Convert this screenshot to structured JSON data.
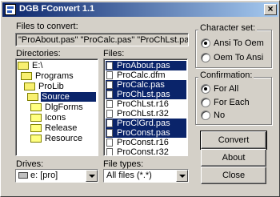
{
  "window": {
    "title": "DGB FConvert 1.1",
    "close_glyph": "×"
  },
  "files_to_convert": {
    "label": "Files to convert:",
    "value": "\"ProAbout.pas\" \"ProCalc.pas\" \"ProChLst.pas\" \"ProClGrd.pas\""
  },
  "directories": {
    "label": "Directories:",
    "items": [
      {
        "label": "E:\\",
        "selected": false
      },
      {
        "label": "Programs",
        "selected": false
      },
      {
        "label": "ProLib",
        "selected": false
      },
      {
        "label": "Source",
        "selected": true
      },
      {
        "label": "DlgForms",
        "selected": false
      },
      {
        "label": "Icons",
        "selected": false
      },
      {
        "label": "Release",
        "selected": false
      },
      {
        "label": "Resource",
        "selected": false
      }
    ]
  },
  "files": {
    "label": "Files:",
    "items": [
      {
        "name": "ProAbout.pas",
        "selected": true
      },
      {
        "name": "ProCalc.dfm",
        "selected": false
      },
      {
        "name": "ProCalc.pas",
        "selected": true
      },
      {
        "name": "ProChLst.pas",
        "selected": true
      },
      {
        "name": "ProChLst.r16",
        "selected": false
      },
      {
        "name": "ProChLst.r32",
        "selected": false
      },
      {
        "name": "ProClGrd.pas",
        "selected": true
      },
      {
        "name": "ProConst.pas",
        "selected": true
      },
      {
        "name": "ProConst.r16",
        "selected": false
      },
      {
        "name": "ProConst.r32",
        "selected": false
      }
    ]
  },
  "drives": {
    "label": "Drives:",
    "value": "e: [pro]"
  },
  "file_types": {
    "label": "File types:",
    "value": "All files (*.*)"
  },
  "character_set": {
    "title": "Character set:",
    "options": [
      {
        "label": "Ansi To Oem",
        "checked": true
      },
      {
        "label": "Oem To Ansi",
        "checked": false
      }
    ]
  },
  "confirmation": {
    "title": "Confirmation:",
    "options": [
      {
        "label": "For All",
        "checked": true
      },
      {
        "label": "For Each",
        "checked": false
      },
      {
        "label": "No",
        "checked": false
      }
    ]
  },
  "buttons": {
    "convert": "Convert",
    "about": "About",
    "close": "Close"
  }
}
